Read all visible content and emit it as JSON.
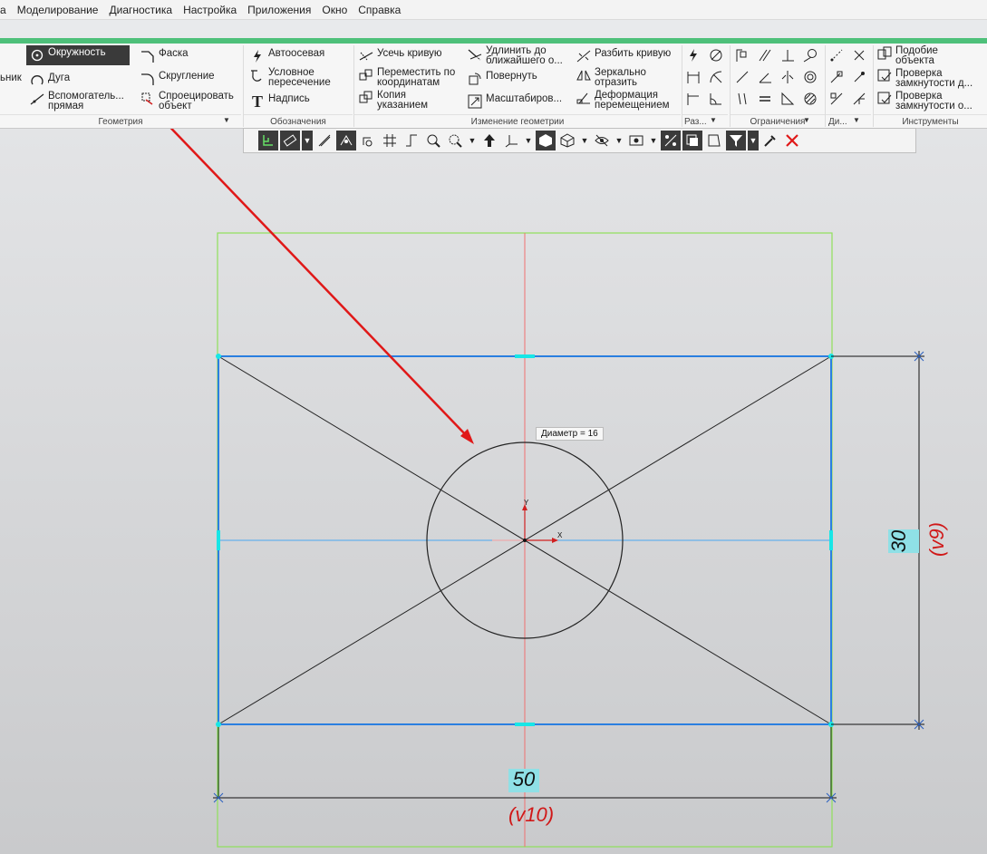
{
  "menu": {
    "items": [
      "а",
      "Моделирование",
      "Диагностика",
      "Настройка",
      "Приложения",
      "Окно",
      "Справка"
    ]
  },
  "ribbon": {
    "geometry": {
      "group_label": "Геометрия",
      "circle": "Окружность",
      "arc": "Дуга",
      "left_cut": "ьник",
      "aux_line_1": "Вспомогатель...",
      "aux_line_2": "прямая",
      "chamfer": "Фаска",
      "fillet": "Скругление",
      "project_1": "Спроецировать",
      "project_2": "объект"
    },
    "notation": {
      "group_label": "Обозначения",
      "axis": "Автоосевая",
      "cond_1": "Условное",
      "cond_2": "пересечение",
      "text": "Надпись"
    },
    "edit": {
      "group_label": "Изменение геометрии",
      "trim": "Усечь кривую",
      "move_1": "Переместить по",
      "move_2": "координатам",
      "copy_1": "Копия",
      "copy_2": "указанием",
      "extend_1": "Удлинить до",
      "extend_2": "ближайшего о...",
      "rotate": "Повернуть",
      "scale": "Масштабиров...",
      "split": "Разбить кривую",
      "mirror_1": "Зеркально",
      "mirror_2": "отразить",
      "deform_1": "Деформация",
      "deform_2": "перемещением"
    },
    "dims_label": "Раз...",
    "constraints_label": "Ограничения",
    "di_label": "Ди...",
    "tools": {
      "group_label": "Инструменты",
      "similar_1": "Подобие",
      "similar_2": "объекта",
      "check1_1": "Проверка",
      "check1_2": "замкнутости д...",
      "check2_1": "Проверка",
      "check2_2": "замкнутости о..."
    }
  },
  "sketch": {
    "tooltip": "Диаметр = 16",
    "dim_height": "30",
    "dim_height_var": "(v9)",
    "dim_width": "50",
    "dim_width_var": "(v10)",
    "axis_y": "Y",
    "axis_x": "X"
  },
  "colors": {
    "sketch_blue": "#2a7fe0",
    "frame_green": "#8fe05a",
    "arrow_red": "#e01818",
    "handle_cyan": "#18e6e6",
    "ribbon_accent": "#4ec07a"
  }
}
